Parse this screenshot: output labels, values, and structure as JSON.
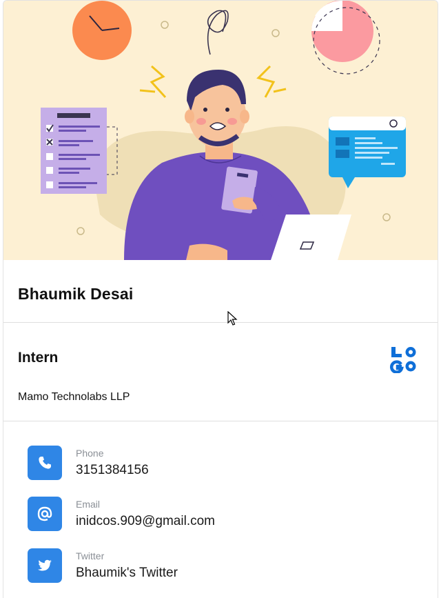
{
  "profile": {
    "name": "Bhaumik Desai",
    "role": "Intern",
    "company": "Mamo Technolabs LLP",
    "logo_text": "LOGO"
  },
  "contacts": [
    {
      "label": "Phone",
      "value": "3151384156",
      "icon": "phone-icon"
    },
    {
      "label": "Email",
      "value": "inidcos.909@gmail.com",
      "icon": "at-icon"
    },
    {
      "label": "Twitter",
      "value": "Bhaumik's Twitter",
      "icon": "twitter-icon"
    }
  ],
  "colors": {
    "accent": "#2f86e6",
    "hero_background": "#fdf0d3"
  }
}
